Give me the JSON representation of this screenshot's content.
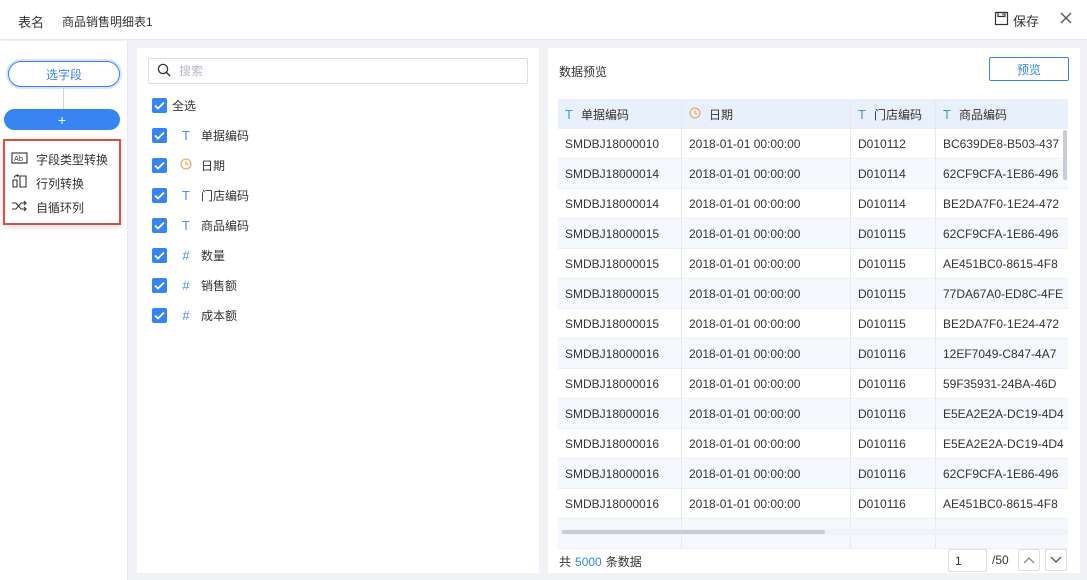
{
  "header": {
    "table_label": "表名",
    "table_name": "商品销售明细表1",
    "save_label": "保存"
  },
  "steps": {
    "pick_fields_label": "选字段",
    "add_label": "+",
    "menu": [
      {
        "label": "字段类型转换",
        "icon": "field-type-convert-icon"
      },
      {
        "label": "行列转换",
        "icon": "row-column-convert-icon"
      },
      {
        "label": "自循环列",
        "icon": "self-loop-icon"
      }
    ]
  },
  "fields_panel": {
    "search_placeholder": "搜索",
    "select_all_label": "全选",
    "fields": [
      {
        "name": "单据编码",
        "type_icon": "T",
        "checked": true
      },
      {
        "name": "日期",
        "type_icon": "clock",
        "checked": true
      },
      {
        "name": "门店编码",
        "type_icon": "T",
        "checked": true
      },
      {
        "name": "商品编码",
        "type_icon": "T",
        "checked": true
      },
      {
        "name": "数量",
        "type_icon": "#",
        "checked": true
      },
      {
        "name": "销售额",
        "type_icon": "#",
        "checked": true
      },
      {
        "name": "成本额",
        "type_icon": "#",
        "checked": true
      }
    ]
  },
  "preview": {
    "title": "数据预览",
    "button_label": "预览",
    "columns": [
      {
        "name": "单据编码",
        "icon": "T"
      },
      {
        "name": "日期",
        "icon": "clock"
      },
      {
        "name": "门店编码",
        "icon": "T"
      },
      {
        "name": "商品编码",
        "icon": "T"
      }
    ],
    "rows": [
      [
        "SMDBJ18000010",
        "2018-01-01 00:00:00",
        "D010112",
        "BC639DE8-B503-437"
      ],
      [
        "SMDBJ18000014",
        "2018-01-01 00:00:00",
        "D010114",
        "62CF9CFA-1E86-496"
      ],
      [
        "SMDBJ18000014",
        "2018-01-01 00:00:00",
        "D010114",
        "BE2DA7F0-1E24-472"
      ],
      [
        "SMDBJ18000015",
        "2018-01-01 00:00:00",
        "D010115",
        "62CF9CFA-1E86-496"
      ],
      [
        "SMDBJ18000015",
        "2018-01-01 00:00:00",
        "D010115",
        "AE451BC0-8615-4F8"
      ],
      [
        "SMDBJ18000015",
        "2018-01-01 00:00:00",
        "D010115",
        "77DA67A0-ED8C-4FE"
      ],
      [
        "SMDBJ18000015",
        "2018-01-01 00:00:00",
        "D010115",
        "BE2DA7F0-1E24-472"
      ],
      [
        "SMDBJ18000016",
        "2018-01-01 00:00:00",
        "D010116",
        "12EF7049-C847-4A7"
      ],
      [
        "SMDBJ18000016",
        "2018-01-01 00:00:00",
        "D010116",
        "59F35931-24BA-46D"
      ],
      [
        "SMDBJ18000016",
        "2018-01-01 00:00:00",
        "D010116",
        "E5EA2E2A-DC19-4D4"
      ],
      [
        "SMDBJ18000016",
        "2018-01-01 00:00:00",
        "D010116",
        "E5EA2E2A-DC19-4D4"
      ],
      [
        "SMDBJ18000016",
        "2018-01-01 00:00:00",
        "D010116",
        "62CF9CFA-1E86-496"
      ],
      [
        "SMDBJ18000016",
        "2018-01-01 00:00:00",
        "D010116",
        "AE451BC0-8615-4F8"
      ],
      [
        "",
        "",
        "",
        ""
      ]
    ],
    "footer": {
      "prefix": "共",
      "count": "5000",
      "suffix": "条数据",
      "page_value": "1",
      "page_total": "/50"
    }
  },
  "colors": {
    "accent": "#3685f2",
    "highlight_border": "#d94f45",
    "date_icon": "#f0a04b"
  }
}
